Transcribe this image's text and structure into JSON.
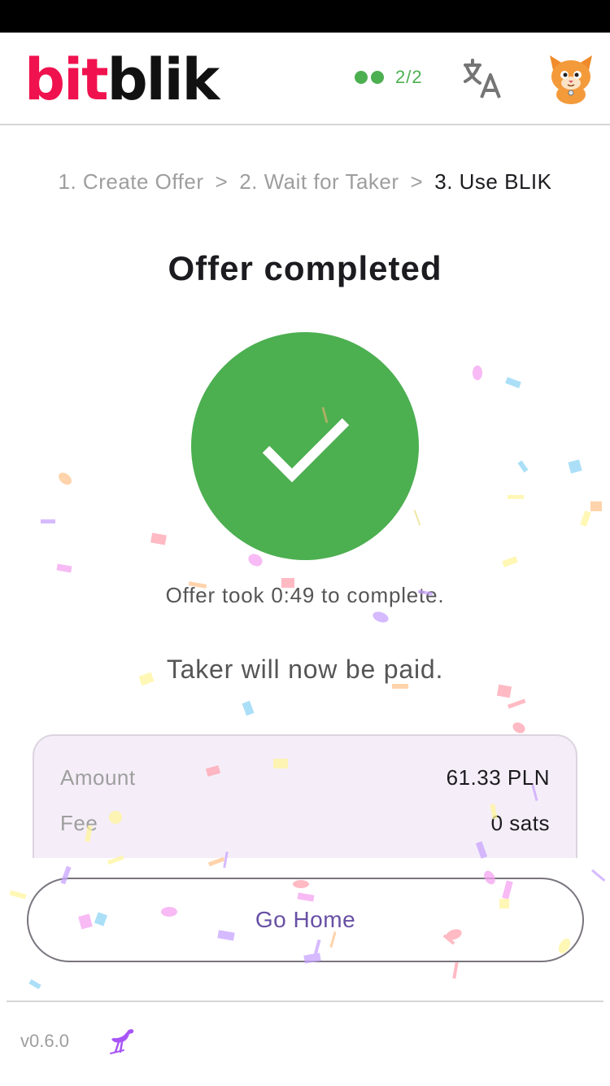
{
  "app": {
    "logo_part1": "bit",
    "logo_part2": "blik"
  },
  "header": {
    "relay_count": "2/2",
    "translate_icon": "translate-icon",
    "avatar_icon": "cat-avatar-icon"
  },
  "stepper": {
    "step1": "1. Create Offer",
    "step2": "2. Wait for Taker",
    "step3": "3. Use BLIK",
    "separator": ">"
  },
  "main": {
    "title": "Offer completed",
    "took_prefix": "Offer took",
    "took_time": "0:49",
    "took_suffix": "to complete.",
    "paid_text": "Taker will now be paid."
  },
  "summary": {
    "amount_label": "Amount",
    "amount_value": "61.33 PLN",
    "fee_label": "Fee",
    "fee_value": "0 sats"
  },
  "actions": {
    "go_home": "Go Home"
  },
  "footer": {
    "version": "v0.6.0",
    "nostr_icon": "nostr-ostrich-icon"
  },
  "colors": {
    "brand_red": "#f0124e",
    "success_green": "#4caf50",
    "primary_purple": "#6750a4",
    "card_bg": "#f5eef8"
  }
}
